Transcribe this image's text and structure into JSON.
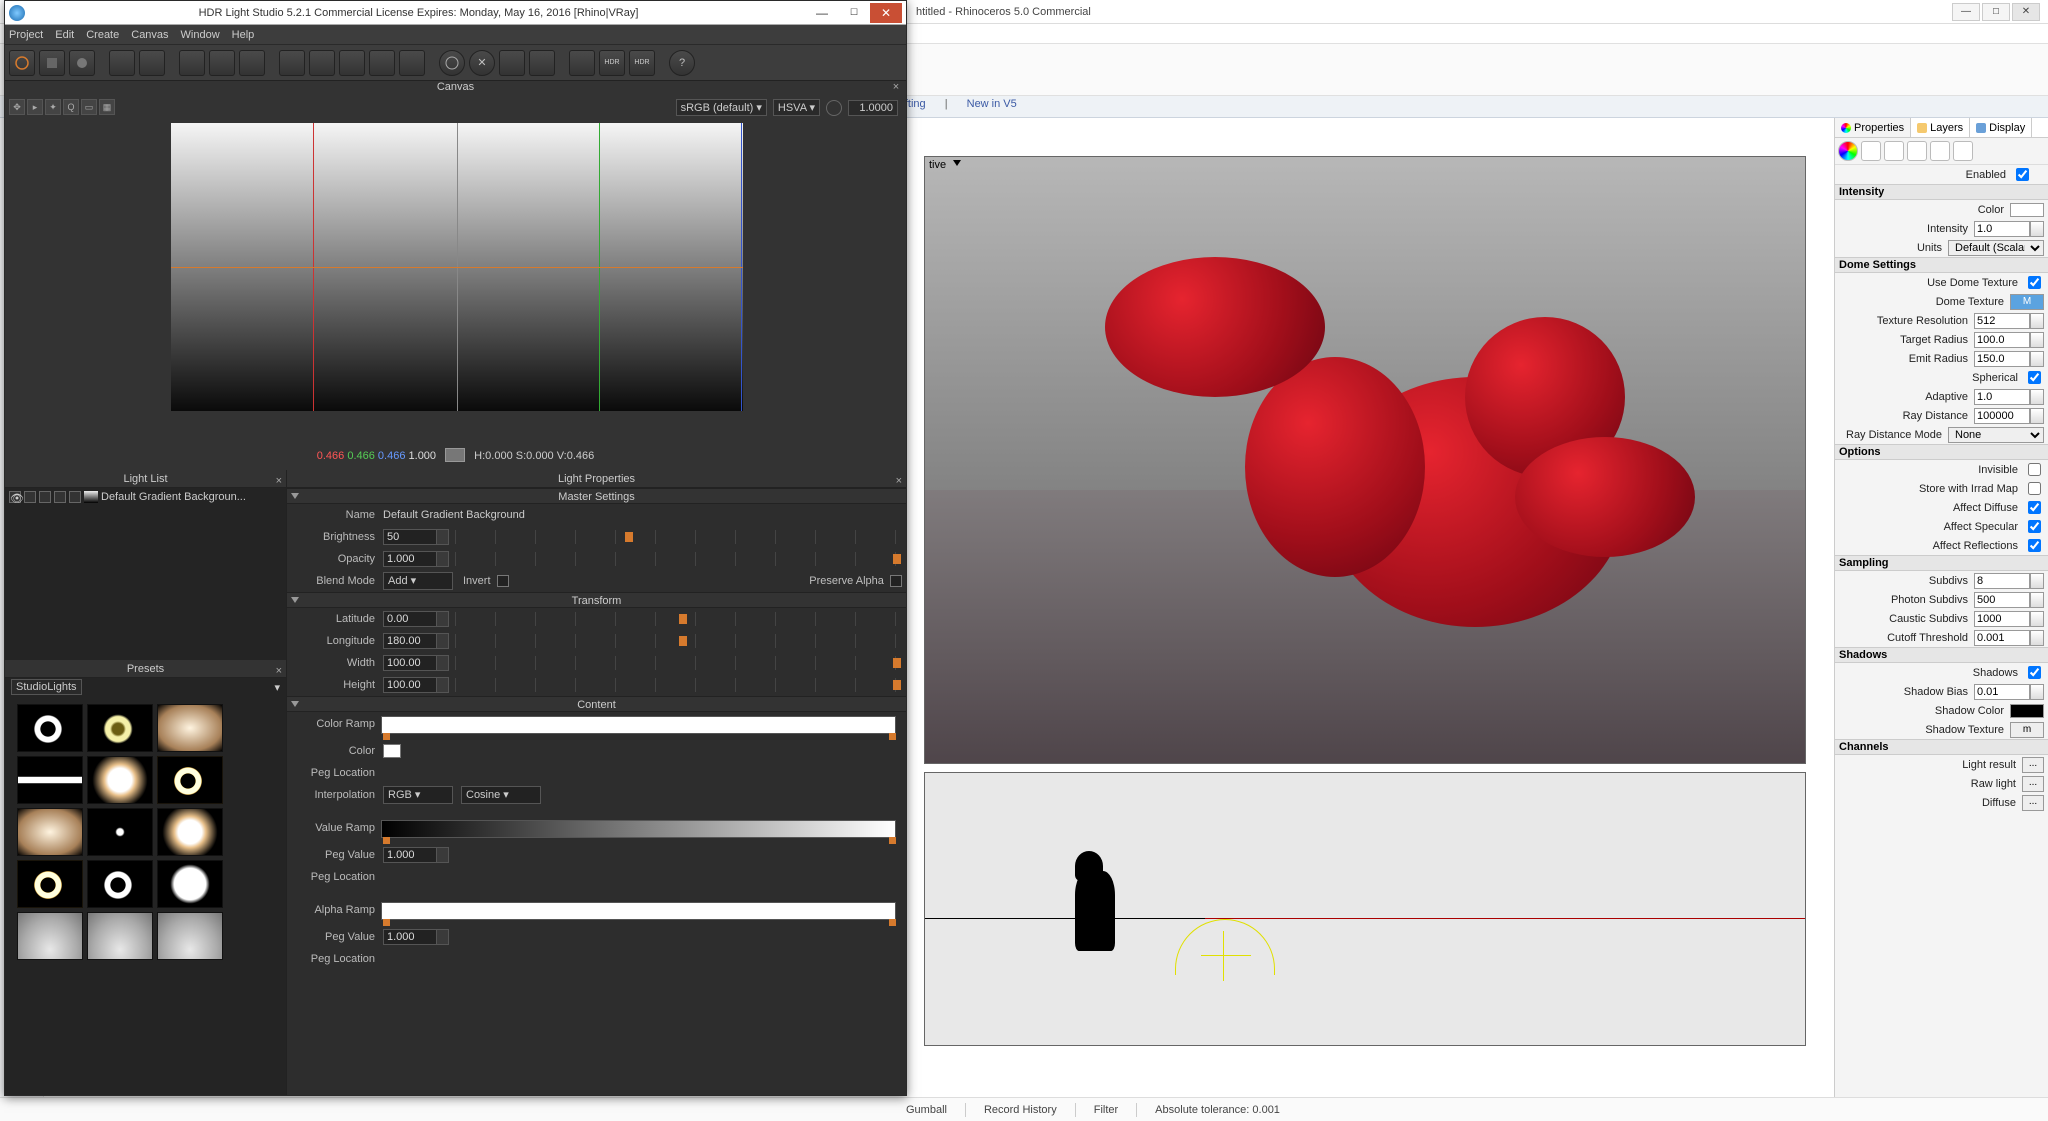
{
  "rhino": {
    "title": "htitled - Rhinoceros 5.0 Commercial",
    "tabs": {
      "drafting": "rafting",
      "new": "New in V5"
    },
    "prop_tabs": {
      "properties": "Properties",
      "layers": "Layers",
      "display": "Display"
    },
    "enabled_label": "Enabled",
    "sections": {
      "intensity": "Intensity",
      "dome": "Dome Settings",
      "options": "Options",
      "sampling": "Sampling",
      "shadows": "Shadows",
      "channels": "Channels"
    },
    "props": {
      "color": "Color",
      "intensity": "Intensity",
      "intensity_v": "1.0",
      "units": "Units",
      "units_v": "Default (Scalar)",
      "use_dome": "Use Dome Texture",
      "dome_tex": "Dome Texture",
      "dome_tex_v": "M",
      "tex_res": "Texture Resolution",
      "tex_res_v": "512",
      "target_r": "Target Radius",
      "target_r_v": "100.0",
      "emit_r": "Emit Radius",
      "emit_r_v": "150.0",
      "spherical": "Spherical",
      "adaptive": "Adaptive",
      "adaptive_v": "1.0",
      "ray_dist": "Ray Distance",
      "ray_dist_v": "100000",
      "ray_mode": "Ray Distance Mode",
      "ray_mode_v": "None",
      "invisible": "Invisible",
      "irrad": "Store with Irrad Map",
      "aff_d": "Affect Diffuse",
      "aff_s": "Affect Specular",
      "aff_r": "Affect Reflections",
      "subdivs": "Subdivs",
      "subdivs_v": "8",
      "photon": "Photon Subdivs",
      "photon_v": "500",
      "caustic": "Caustic Subdivs",
      "caustic_v": "1000",
      "cutoff": "Cutoff Threshold",
      "cutoff_v": "0.001",
      "shadows": "Shadows",
      "bias": "Shadow Bias",
      "bias_v": "0.01",
      "scolor": "Shadow Color",
      "stex": "Shadow Texture",
      "stex_v": "m",
      "lresult": "Light result",
      "rawlight": "Raw light",
      "diffuse": "Diffuse"
    },
    "status": {
      "gumball": "Gumball",
      "record": "Record History",
      "filter": "Filter",
      "tol": "Absolute tolerance: 0.001"
    }
  },
  "hdr": {
    "title": "HDR Light Studio 5.2.1 Commercial License Expires: Monday, May 16, 2016  [Rhino|VRay]",
    "menus": [
      "Project",
      "Edit",
      "Create",
      "Canvas",
      "Window",
      "Help"
    ],
    "canvas": {
      "title": "Canvas",
      "colorspace": "sRGB (default)",
      "mode": "HSVA",
      "exposure": "1.0000",
      "readout_r": "0.466",
      "readout_g": "0.466",
      "readout_b": "0.466",
      "readout_w": "1.000",
      "readout_hsv": "H:0.000 S:0.000 V:0.466"
    },
    "lightlist": {
      "title": "Light List",
      "item": "Default Gradient Backgroun..."
    },
    "presets": {
      "title": "Presets",
      "category": "StudioLights"
    },
    "lp": {
      "title": "Light Properties",
      "sec_master": "Master Settings",
      "name_l": "Name",
      "name_v": "Default Gradient Background",
      "bright_l": "Brightness",
      "bright_v": "50",
      "opacity_l": "Opacity",
      "opacity_v": "1.000",
      "blend_l": "Blend Mode",
      "blend_v": "Add",
      "invert_l": "Invert",
      "preserve_l": "Preserve Alpha",
      "sec_transform": "Transform",
      "lat_l": "Latitude",
      "lat_v": "0.00",
      "lon_l": "Longitude",
      "lon_v": "180.00",
      "width_l": "Width",
      "width_v": "100.00",
      "height_l": "Height",
      "height_v": "100.00",
      "sec_content": "Content",
      "cramp_l": "Color Ramp",
      "color_l": "Color",
      "pegloc_l": "Peg Location",
      "interp_l": "Interpolation",
      "interp_v1": "RGB",
      "interp_v2": "Cosine",
      "vramp_l": "Value Ramp",
      "pegval_l": "Peg Value",
      "pegval_v": "1.000",
      "aramp_l": "Alpha Ramp"
    }
  }
}
